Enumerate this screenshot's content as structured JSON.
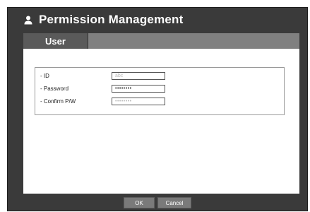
{
  "window": {
    "title": "Permission Management",
    "title_icon": "user-icon"
  },
  "tabs": [
    {
      "label": "User",
      "selected": true
    }
  ],
  "form": {
    "id_label": "- ID",
    "id_placeholder": "abc",
    "password_label": "- Password",
    "password_value": "••••••••",
    "confirm_label": "- Confirm P/W",
    "confirm_placeholder": "••••••••"
  },
  "buttons": {
    "ok": "OK",
    "cancel": "Cancel"
  },
  "colors": {
    "window_bg": "#3a3a3a",
    "tab_strip": "#808080",
    "tab_selected": "#5a5a5a",
    "button_bg": "#7a7a7a"
  }
}
